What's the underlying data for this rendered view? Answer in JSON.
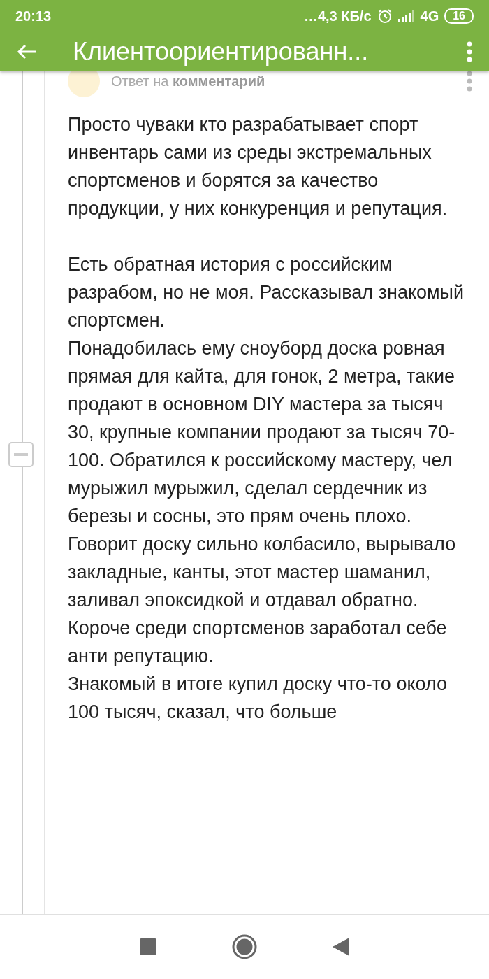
{
  "status_bar": {
    "time": "20:13",
    "speed": "…4,3 КБ/с",
    "network": "4G",
    "battery": "16"
  },
  "app_bar": {
    "title": "Клиентоориентированн..."
  },
  "comment": {
    "reply_prefix": "Ответ на",
    "reply_target": "комментарий",
    "collapsed": false,
    "paragraphs": [
      "Просто чуваки кто разрабатывает спорт инвентарь сами из среды экстремальных спортсменов и борятся за качество продукции, у них конкуренция и репутация.",
      "Есть обратная история с российским разрабом, но не моя. Рассказывал знакомый спортсмен.",
      "Понадобилась ему сноуборд доска ровная прямая для кайта, для гонок, 2 метра, такие продают в основном DIY мастера за тысяч 30, крупные компании продают за тысяч 70-100. Обратился к российскому мастеру, чел мурыжил мурыжил, сделал сердечник из березы и сосны, это прям очень плохо. Говорит доску сильно колбасило, вырывало закладные, канты, этот мастер шаманил, заливал эпоксидкой и отдавал обратно. Короче среди спортсменов заработал себе анти репутацию.",
      "Знакомый в итоге купил доску что-то около 100 тысяч, сказал, что больше"
    ]
  }
}
